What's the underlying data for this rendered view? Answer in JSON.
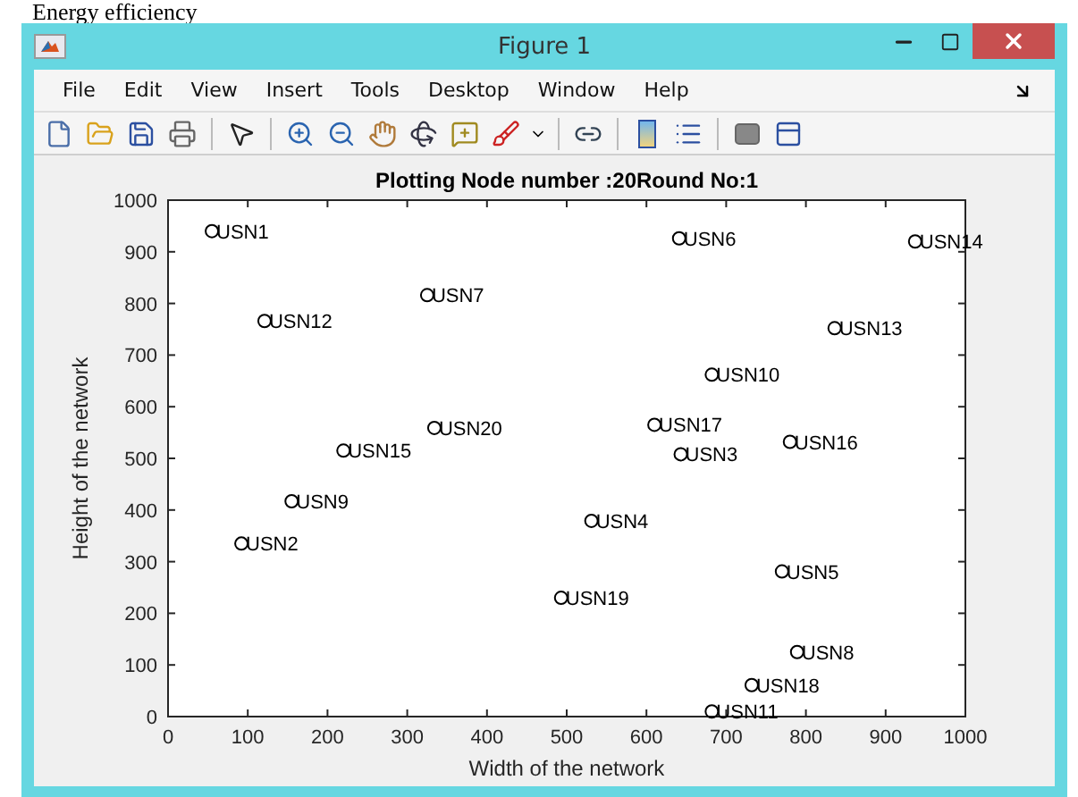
{
  "document_heading": "Energy efficiency",
  "window": {
    "title": "Figure 1"
  },
  "menu": [
    "File",
    "Edit",
    "View",
    "Insert",
    "Tools",
    "Desktop",
    "Window",
    "Help"
  ],
  "figure": {
    "chart_data": {
      "type": "scatter",
      "title": "Plotting Node number :20Round No:1",
      "xlabel": "Width of the network",
      "ylabel": "Height of the network",
      "x": [
        55,
        92,
        643,
        531,
        770,
        641,
        325,
        789,
        155,
        682,
        682,
        121,
        836,
        937,
        220,
        780,
        610,
        732,
        493,
        334
      ],
      "series": [
        {
          "color": "#000000",
          "values": [
            940,
            335,
            508,
            379,
            281,
            926,
            816,
            125,
            417,
            662,
            10,
            766,
            752,
            920,
            515,
            532,
            565,
            61,
            230,
            559
          ]
        }
      ],
      "value_labels": [
        "USN1",
        "USN2",
        "USN3",
        "USN4",
        "USN5",
        "USN6",
        "USN7",
        "USN8",
        "USN9",
        "USN10",
        "USN11",
        "USN12",
        "USN13",
        "USN14",
        "USN15",
        "USN16",
        "USN17",
        "USN18",
        "USN19",
        "USN20"
      ],
      "xlim": [
        0,
        1000
      ],
      "ylim": [
        0,
        1000
      ],
      "xticks": [
        0,
        100,
        200,
        300,
        400,
        500,
        600,
        700,
        800,
        900,
        1000
      ],
      "yticks": [
        0,
        100,
        200,
        300,
        400,
        500,
        600,
        700,
        800,
        900,
        1000
      ]
    }
  }
}
